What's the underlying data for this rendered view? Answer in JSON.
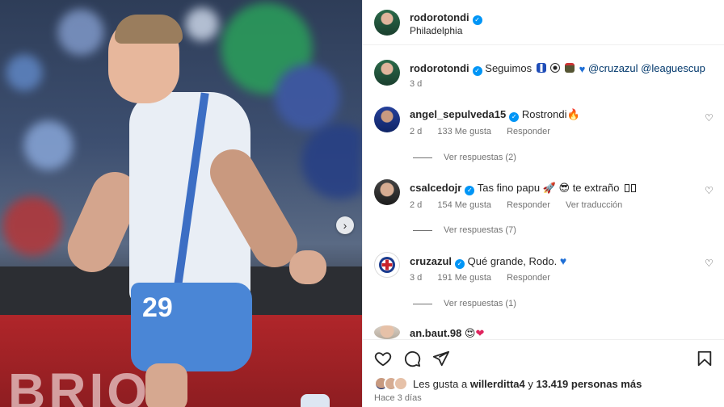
{
  "post": {
    "media": {
      "carousel_next_icon": "chevron-right-icon",
      "jersey_number": "29"
    },
    "header": {
      "username": "rodorotondi",
      "location": "Philadelphia"
    },
    "caption": {
      "username": "rodorotondi",
      "text": "Seguimos",
      "emojis": [
        "blue-white-flag",
        "soccer-ball",
        "clapperboard",
        "blue-heart"
      ],
      "mentions": "@cruzazul @leaguescup",
      "time": "3 d"
    },
    "comments": [
      {
        "username": "angel_sepulveda15",
        "verified": true,
        "text": "Rostrondi",
        "emoji": "fire",
        "time": "2 d",
        "likes": "133 Me gusta",
        "reply": "Responder",
        "view_replies": "Ver respuestas (2)"
      },
      {
        "username": "csalcedojr",
        "verified": true,
        "text": "Tas fino papu",
        "text_after": "te extraño",
        "emoji": "rocket sunglasses",
        "time": "2 d",
        "likes": "154 Me gusta",
        "reply": "Responder",
        "translate": "Ver traducción",
        "view_replies": "Ver respuestas (7)"
      },
      {
        "username": "cruzazul",
        "verified": true,
        "text": "Qué grande, Rodo.",
        "emoji": "blue-heart",
        "time": "3 d",
        "likes": "191 Me gusta",
        "reply": "Responder",
        "view_replies": "Ver respuestas (1)"
      },
      {
        "username": "an.baut.98",
        "verified": false,
        "text": "",
        "emoji": "heart-eyes red-heart"
      }
    ],
    "actions": {
      "like_icon": "heart-icon",
      "comment_icon": "comment-icon",
      "share_icon": "send-icon",
      "save_icon": "bookmark-icon"
    },
    "likes": {
      "prefix": "Les gusta a",
      "user": "willerditta4",
      "middle": "y",
      "count": "13.419 personas más"
    },
    "posted_ago": "Hace 3 días",
    "colors": {
      "verified": "#0095f6",
      "mention": "#00376b",
      "muted": "#737373"
    }
  }
}
